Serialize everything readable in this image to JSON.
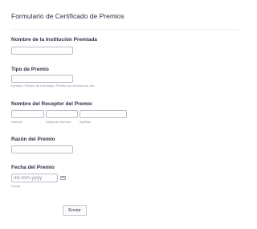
{
  "form": {
    "title": "Formulario de Certificado de Premios",
    "institution": {
      "label": "Nombre de la Institución Premiada"
    },
    "award_type": {
      "label": "Tipo de Premio",
      "hint": "Ejemplo: Premio de Liderazgo, Premio por Excelencia, etc."
    },
    "recipient": {
      "label": "Nombre del Receptor del Premio",
      "first_label": "Nombre",
      "middle_label": "Segundo Nombre",
      "last_label": "Apellido"
    },
    "reason": {
      "label": "Razón del Premio"
    },
    "date": {
      "label": "Fecha del Premio",
      "placeholder": "dd-mm-yyyy",
      "sublabel": "Fecha",
      "icon": "calendar-icon"
    },
    "submit_label": "Enviar"
  }
}
